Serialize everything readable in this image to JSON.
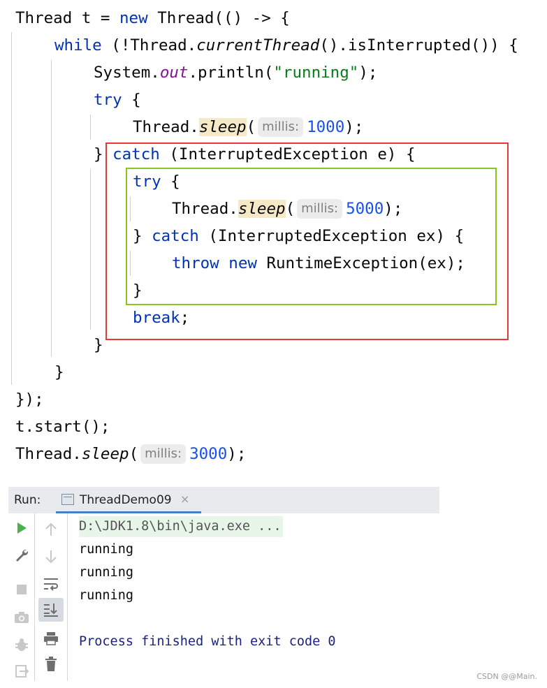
{
  "code": {
    "l1": {
      "a": "Thread t = ",
      "b": "new",
      "c": " Thread(() -> {"
    },
    "l2": {
      "a": "while",
      "b": " (!Thread.",
      "c": "currentThread",
      "d": "().isInterrupted()) {"
    },
    "l3": {
      "a": "System.",
      "b": "out",
      "c": ".println(",
      "d": "\"running\"",
      "e": ");"
    },
    "l4": {
      "a": "try",
      "b": " {"
    },
    "l5": {
      "a": "Thread.",
      "b": "sleep",
      "c": "(",
      "hint": "millis:",
      "num": "1000",
      "d": ");"
    },
    "l6": {
      "a": "} ",
      "b": "catch",
      "c": " (InterruptedException e) {"
    },
    "l7": {
      "a": "try",
      "b": " {"
    },
    "l8": {
      "a": "Thread.",
      "b": "sleep",
      "c": "(",
      "hint": "millis:",
      "num": "5000",
      "d": ");"
    },
    "l9": {
      "a": "} ",
      "b": "catch",
      "c": " (InterruptedException ex) {"
    },
    "l10": {
      "a": "throw",
      "b": " ",
      "c": "new",
      "d": " RuntimeException(ex);"
    },
    "l11": {
      "a": "}"
    },
    "l12": {
      "a": "break",
      "b": ";"
    },
    "l13": {
      "a": "}"
    },
    "l14": {
      "a": "}"
    },
    "l15": {
      "a": "});"
    },
    "l16": {
      "a": "t.start();"
    },
    "l17": {
      "a": "Thread.",
      "b": "sleep",
      "c": "(",
      "hint": "millis:",
      "num": "3000",
      "d": ");"
    }
  },
  "run": {
    "label": "Run:",
    "tab_title": "ThreadDemo09",
    "tab_close": "×",
    "console": [
      "D:\\JDK1.8\\bin\\java.exe ...",
      "running",
      "running",
      "running",
      "",
      "Process finished with exit code 0"
    ]
  },
  "icons": {
    "run": "play-icon",
    "settings": "wrench-icon",
    "stop": "stop-icon",
    "snapshot": "camera-icon",
    "debug": "bug-icon",
    "exit": "exit-icon",
    "up": "arrow-up-icon",
    "down": "arrow-down-icon",
    "wrap": "soft-wrap-icon",
    "scroll": "scroll-to-end-icon",
    "print": "print-icon",
    "trash": "trash-icon"
  },
  "colors": {
    "keyword": "#0033b3",
    "string": "#067d17",
    "number": "#1750eb",
    "field": "#871094",
    "red_box": "#e53935",
    "green_box": "#8dc21f",
    "accent": "#4083c9"
  },
  "watermark": "CSDN @@Main."
}
